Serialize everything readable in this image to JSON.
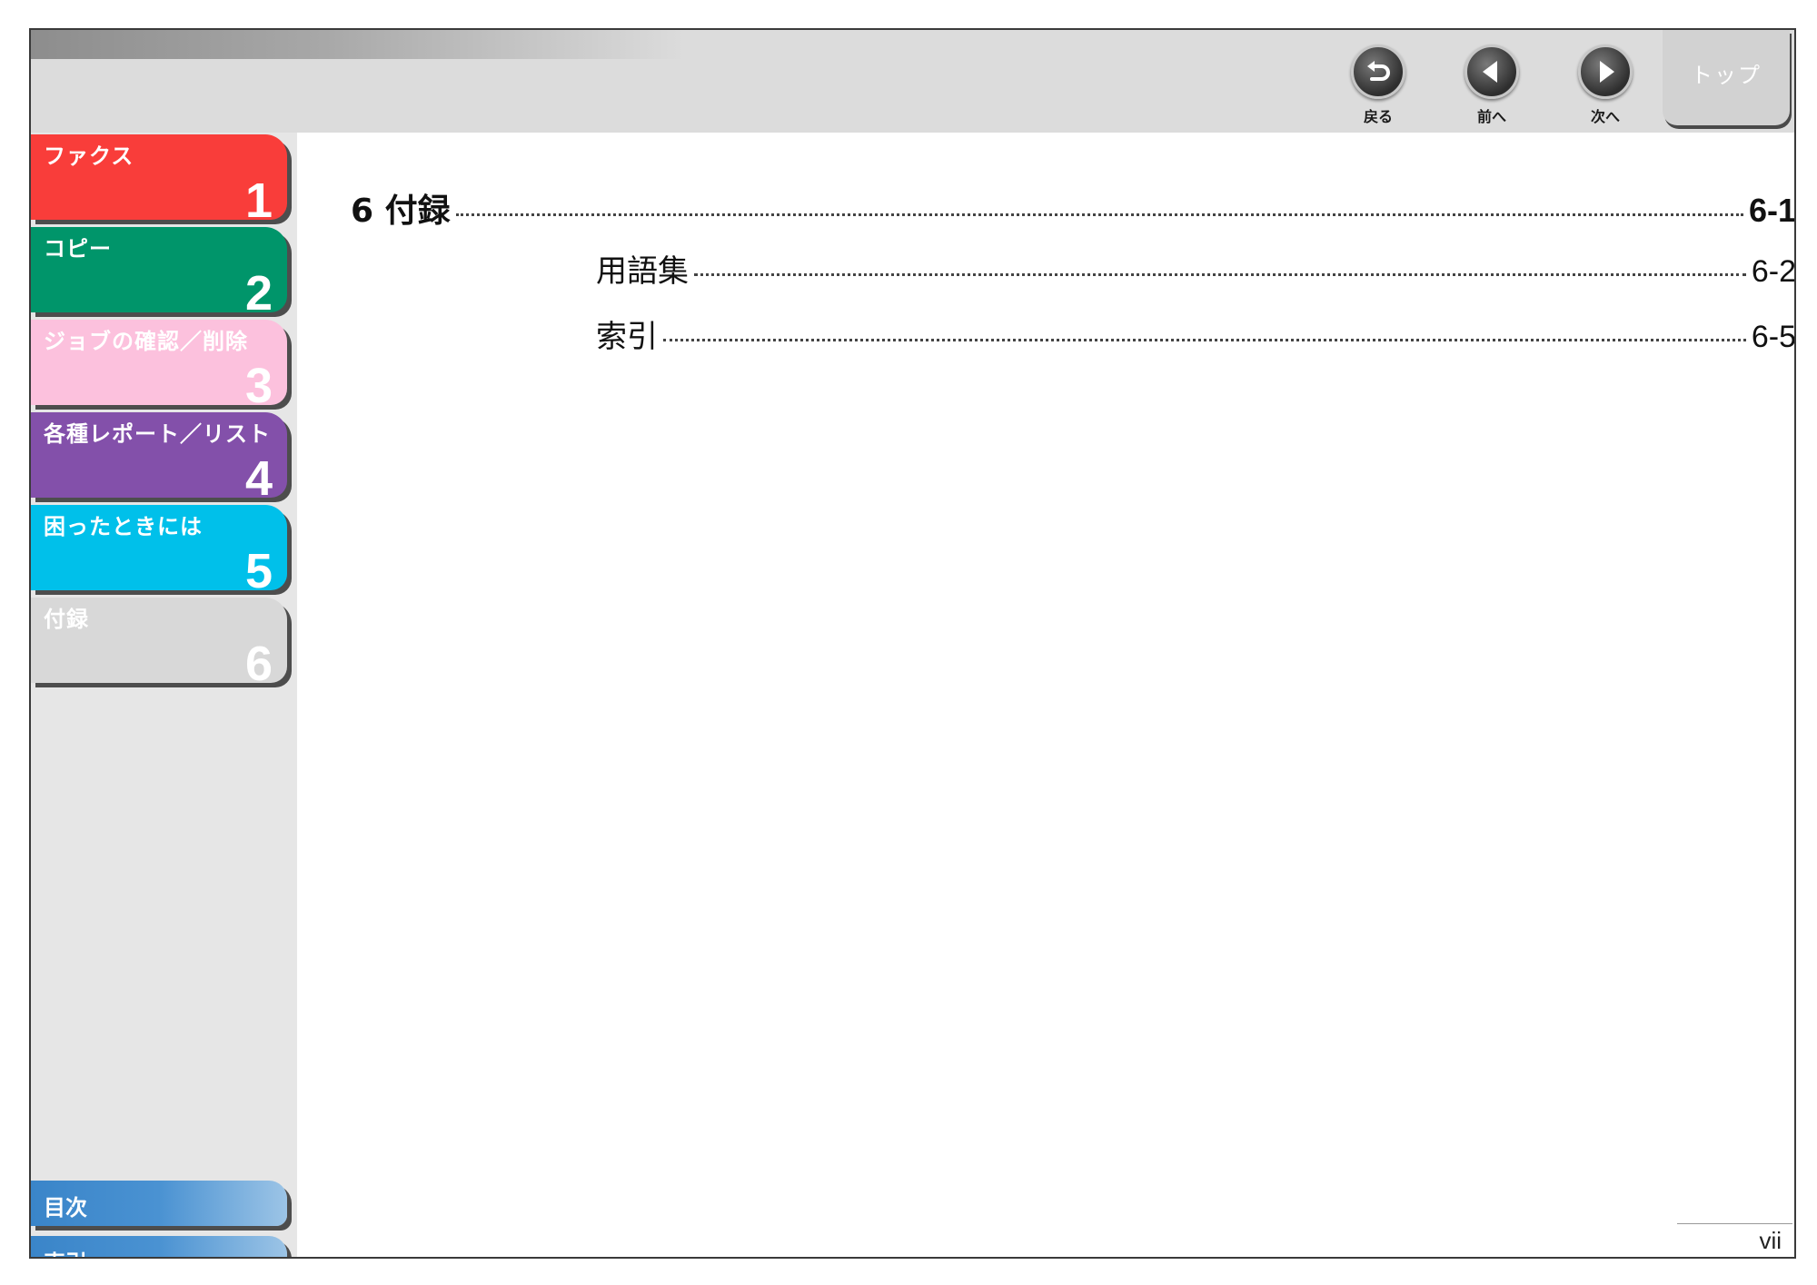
{
  "nav": {
    "back_label": "戻る",
    "prev_label": "前へ",
    "next_label": "次へ",
    "top_label": "トップ"
  },
  "sidebar": {
    "chapters": [
      {
        "label": "ファクス",
        "number": "1",
        "color": "#f93d3a"
      },
      {
        "label": "コピー",
        "number": "2",
        "color": "#00956a"
      },
      {
        "label": "ジョブの確認／削除",
        "number": "3",
        "color": "#fcc1dd"
      },
      {
        "label": "各種レポート／リスト",
        "number": "4",
        "color": "#8350aa"
      },
      {
        "label": "困ったときには",
        "number": "5",
        "color": "#00c0ea"
      },
      {
        "label": "付録",
        "number": "6",
        "color": "#d8d8d8"
      }
    ],
    "contents_label": "目次",
    "index_label": "索引"
  },
  "toc": {
    "main": {
      "title": "6 付録",
      "page": "6-1"
    },
    "items": [
      {
        "title": "用語集",
        "page": "6-2"
      },
      {
        "title": "索引",
        "page": "6-5"
      }
    ]
  },
  "page_number": "vii"
}
